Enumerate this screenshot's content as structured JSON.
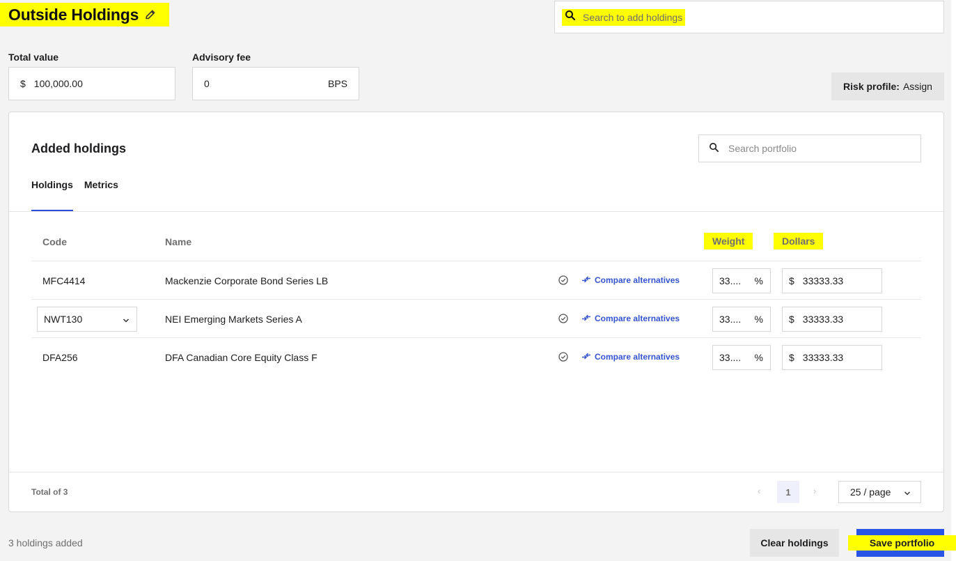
{
  "header": {
    "title": "Outside Holdings",
    "search_placeholder": "Search to add holdings"
  },
  "fields": {
    "total_value_label": "Total value",
    "total_value_prefix": "$",
    "total_value": "100,000.00",
    "advisory_fee_label": "Advisory fee",
    "advisory_fee": "0",
    "advisory_fee_unit": "BPS"
  },
  "risk_profile": {
    "label": "Risk profile:",
    "value": "Assign"
  },
  "card": {
    "title": "Added holdings",
    "search_placeholder": "Search portfolio",
    "tabs": [
      {
        "label": "Holdings",
        "active": true
      },
      {
        "label": "Metrics",
        "active": false
      }
    ],
    "columns": {
      "code": "Code",
      "name": "Name",
      "weight": "Weight",
      "dollars": "Dollars"
    },
    "rows": [
      {
        "code": "MFC4414",
        "name": "Mackenzie Corporate Bond Series LB",
        "compare": "Compare alternatives",
        "weight": "33....",
        "weight_unit": "%",
        "dollar_prefix": "$",
        "dollars": "33333.33"
      },
      {
        "code": "NWT130",
        "name": "NEI Emerging Markets Series A",
        "compare": "Compare alternatives",
        "weight": "33....",
        "weight_unit": "%",
        "dollar_prefix": "$",
        "dollars": "33333.33"
      },
      {
        "code": "DFA256",
        "name": "DFA Canadian Core Equity Class F",
        "compare": "Compare alternatives",
        "weight": "33....",
        "weight_unit": "%",
        "dollar_prefix": "$",
        "dollars": "33333.33"
      }
    ],
    "footer": {
      "total": "Total of 3",
      "current_page": "1",
      "per_page": "25 / page"
    }
  },
  "bottom": {
    "count": "3 holdings added",
    "clear_label": "Clear holdings",
    "save_label": "Save portfolio"
  },
  "colors": {
    "accent": "#2855e6",
    "link": "#3454d1",
    "highlight": "#ffff00",
    "background": "#f3f3f3"
  },
  "icons": {
    "edit": "pencil-icon",
    "search": "search-icon",
    "check": "check-circle-icon",
    "compare": "compare-arrows-icon",
    "chevron": "chevron-down-icon"
  }
}
